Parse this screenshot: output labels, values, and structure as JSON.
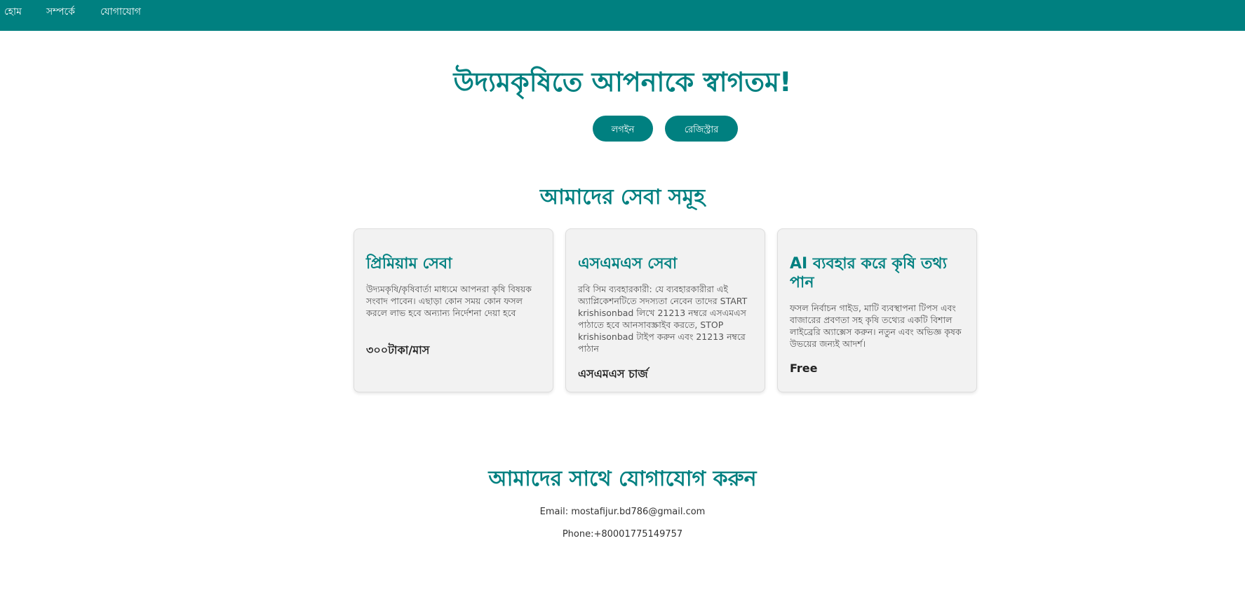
{
  "nav": {
    "items": [
      {
        "label": "হোম"
      },
      {
        "label": "সম্পর্কে"
      },
      {
        "label": "যোগাযোগ"
      }
    ]
  },
  "hero": {
    "title": "উদ্যমকৃষিতে আপনাকে স্বাগতম!",
    "login_label": "লগইন",
    "register_label": "রেজিস্ট্রার"
  },
  "services": {
    "title": "আমাদের সেবা সমূহ",
    "cards": [
      {
        "title": "প্রিমিয়াম সেবা",
        "description": "উদ্যমকৃষি/কৃষিবার্তা মাধ্যমে আপনরা কৃষি বিষয়ক সংবাদ পাবেন। এছাড়া কোন সময় কোন ফসল করলে লাভ হবে অন্যান্য নির্দেশনা দেয়া হবে",
        "price": "৩০০টাকা/মাস"
      },
      {
        "title": "এসএমএস সেবা",
        "description": "রবি সিম ব্যবহারকারী: যে ব্যবহারকারীরা এই অ্যাপ্লিকেশনটিতে সদস্যতা নেবেন তাদের START krishisonbad লিখে 21213 নম্বরে এসএমএস পাঠাতে হবে আনসাবস্ক্রাইব করতে, STOP krishisonbad টাইপ করুন এবং 21213 নম্বরে পাঠান",
        "price": "এসএমএস চার্জ"
      },
      {
        "title": "AI ব্যবহার করে কৃষি তথ্য পান",
        "description": "ফসল নির্বাচন গাইড, মাটি ব্যবস্থাপনা টিপস এবং বাজারের প্রবণতা সহ কৃষি তথ্যের একটি বিশাল লাইব্রেরি অ্যাক্সেস করুন। নতুন এবং অভিজ্ঞ কৃষক উভয়ের জন্যই আদর্শ।",
        "price": "Free"
      }
    ]
  },
  "contact": {
    "title": "আমাদের সাথে যোগাযোগ করুন",
    "email": "Email: mostafijur.bd786@gmail.com",
    "phone": "Phone:+80001775149757"
  },
  "colors": {
    "primary": "#008080",
    "card_bg": "#f2f2f2"
  }
}
